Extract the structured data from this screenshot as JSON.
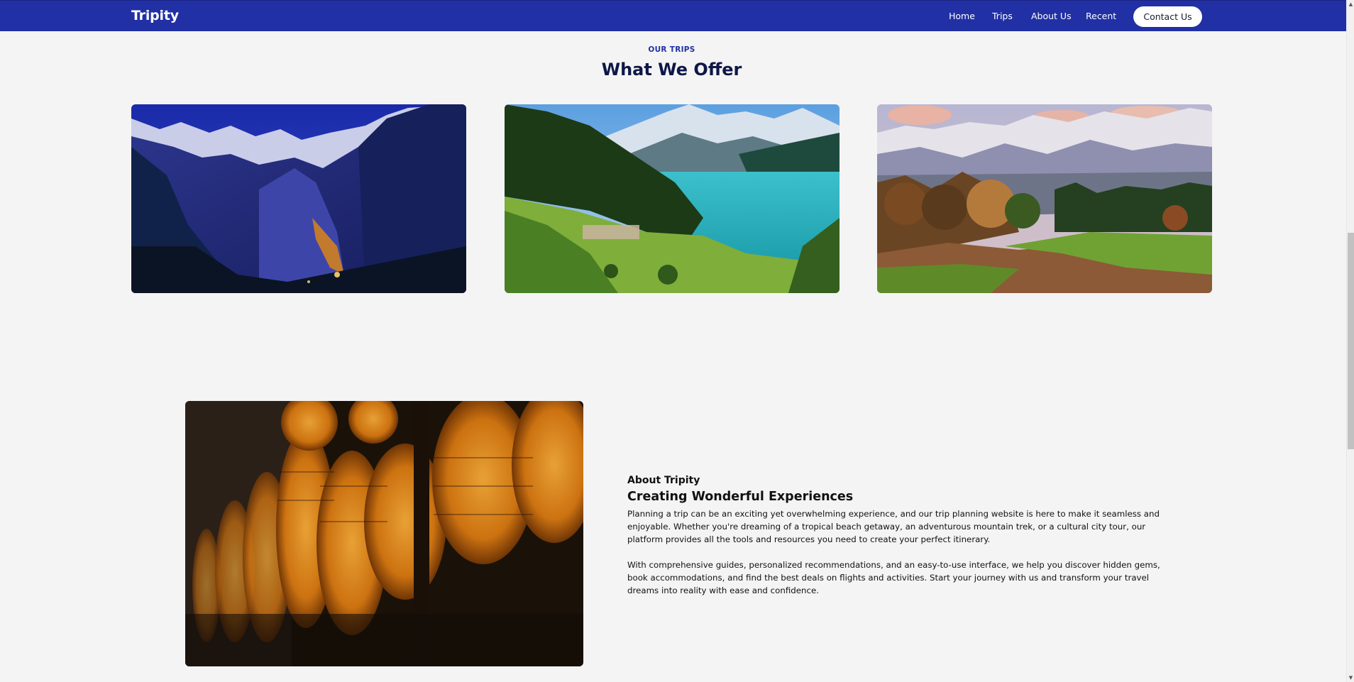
{
  "navbar": {
    "brand": "Tripity",
    "links": [
      "Home",
      "Trips",
      "About Us",
      "Recent"
    ],
    "contact_label": "Contact Us"
  },
  "trips_section": {
    "eyebrow": "OUR TRIPS",
    "title": "What We Offer",
    "cards": [
      {
        "image": "night-alpine-valley-photo"
      },
      {
        "image": "turquoise-lake-village-photo"
      },
      {
        "image": "autumn-field-mountains-photo"
      }
    ]
  },
  "about_section": {
    "image": "paper-lanterns-photo",
    "eyebrow": "About Tripity",
    "title": "Creating Wonderful Experiences",
    "paragraph1": "Planning a trip can be an exciting yet overwhelming experience, and our trip planning website is here to make it seamless and enjoyable. Whether you're dreaming of a tropical beach getaway, an adventurous mountain trek, or a cultural city tour, our platform provides all the tools and resources you need to create your perfect itinerary.",
    "paragraph2": "With comprehensive guides, personalized recommendations, and an easy-to-use interface, we help you discover hidden gems, book accommodations, and find the best deals on flights and activities. Start your journey with us and transform your travel dreams into reality with ease and confidence."
  },
  "colors": {
    "navbar": "#2130a4",
    "title": "#0e1747",
    "background": "#f4f4f4"
  }
}
